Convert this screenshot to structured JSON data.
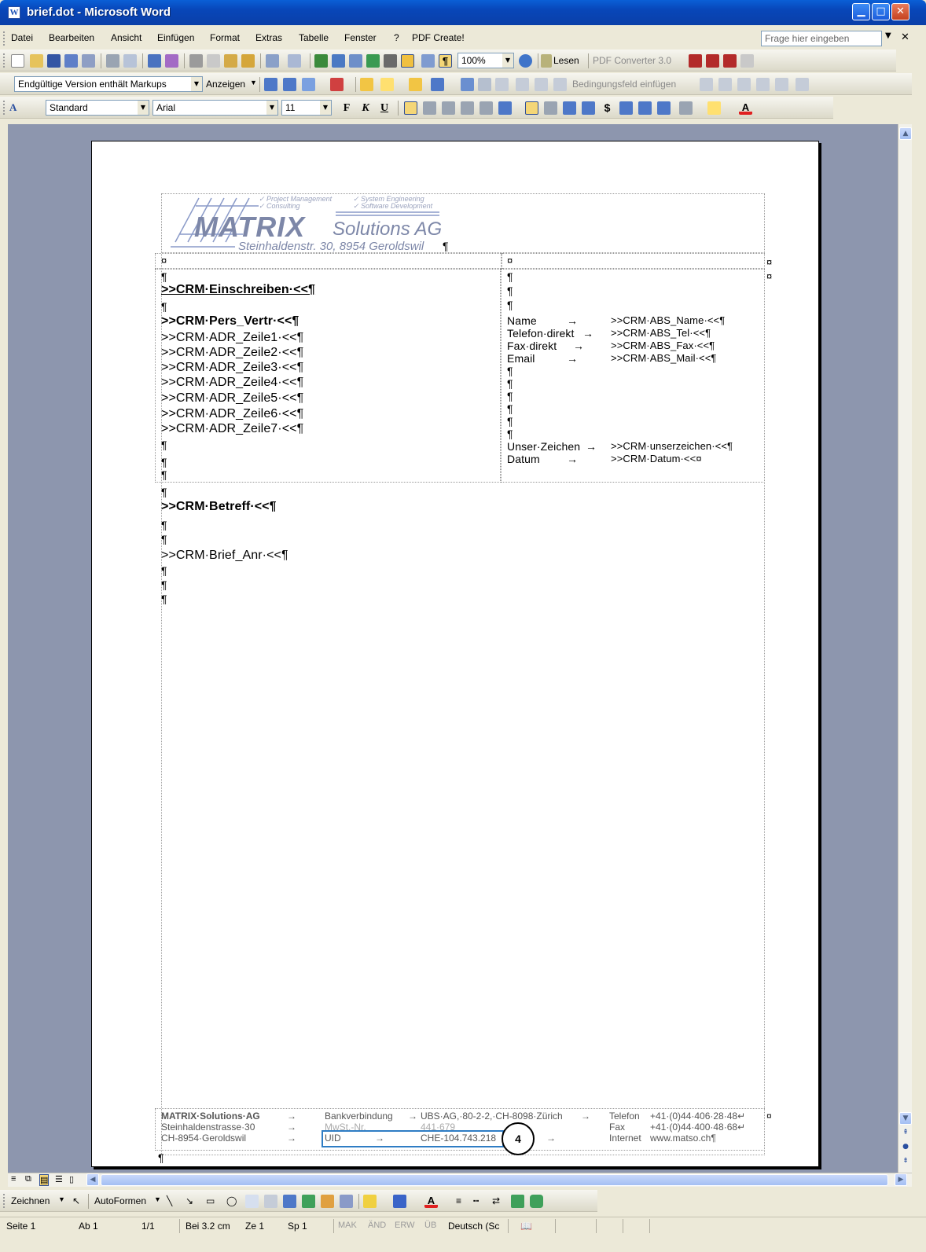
{
  "window": {
    "title": "brief.dot - Microsoft Word",
    "icon": "word-doc-icon"
  },
  "menu": {
    "items": [
      "Datei",
      "Bearbeiten",
      "Ansicht",
      "Einfügen",
      "Format",
      "Extras",
      "Tabelle",
      "Fenster",
      "?",
      "PDF Create!"
    ],
    "help_placeholder": "Frage hier eingeben"
  },
  "toolbar_standard": {
    "zoom": "100%",
    "read_label": "Lesen",
    "pdf_converter": "PDF Converter 3.0"
  },
  "toolbar_review": {
    "markup_view": "Endgültige Version enthält Markups",
    "show_label": "Anzeigen",
    "field_label": "Bedingungsfeld einfügen"
  },
  "toolbar_format": {
    "style": "Standard",
    "font": "Arial",
    "size": "11",
    "bold": "F",
    "italic": "K",
    "underline": "U"
  },
  "document": {
    "logo": {
      "company": "MATRIX",
      "solutions": "Solutions AG",
      "tag1": "✓ Project Management",
      "tag2": "✓ Consulting",
      "tag3": "✓ System Engineering",
      "tag4": "✓ Software Development",
      "address": "Steinhaldenstr. 30, 8954 Geroldswil",
      "pilcrow": "¶"
    },
    "cell_mark": "¤",
    "pilcrow": "¶",
    "left_col": {
      "einschreiben": ">>CRM·Einschreiben·<<¶",
      "pers_vertr": ">>CRM·Pers_Vertr·<<¶",
      "addr_lines": [
        ">>CRM·ADR_Zeile1·<<¶",
        ">>CRM·ADR_Zeile2·<<¶",
        ">>CRM·ADR_Zeile3·<<¶",
        ">>CRM·ADR_Zeile4·<<¶",
        ">>CRM·ADR_Zeile5·<<¶",
        ">>CRM·ADR_Zeile6·<<¶",
        ">>CRM·ADR_Zeile7·<<¶"
      ]
    },
    "right_col": {
      "name_label": "Name",
      "name_value": ">>CRM·ABS_Name·<<¶",
      "tel_label": "Telefon·direkt",
      "tel_value": ">>CRM·ABS_Tel·<<¶",
      "fax_label": "Fax·direkt",
      "fax_value": ">>CRM·ABS_Fax·<<¶",
      "email_label": "Email",
      "email_value": ">>CRM·ABS_Mail·<<¶",
      "zeichen_label": "Unser·Zeichen",
      "zeichen_value": ">>CRM·unserzeichen·<<¶",
      "datum_label": "Datum",
      "datum_value": ">>CRM·Datum·<<¤",
      "arrow": "→"
    },
    "betreff": ">>CRM·Betreff·<<¶",
    "anrede": ">>CRM·Brief_Anr·<<¶",
    "footer": {
      "company": "MATRIX·Solutions·AG",
      "street": "Steinhaldenstrasse·30",
      "city": "CH-8954·Geroldswil",
      "bank_label": "Bankverbindung",
      "bank_value": "UBS·AG,·80-2-2,·CH-8098·Zürich",
      "mwst_label": "MwSt.-Nr.",
      "mwst_value": "441·679",
      "uid_label": "UID",
      "uid_value": "CHE-104.743.218",
      "phone_label": "Telefon",
      "phone_value": "+41·(0)44·406·28·48↵",
      "fax_label": "Fax",
      "fax_value": "+41·(0)44·400·48·68↵",
      "internet_label": "Internet",
      "internet_value": "www.matso.ch¶"
    }
  },
  "callout": {
    "number": "4"
  },
  "draw_toolbar": {
    "draw_label": "Zeichnen",
    "autoshapes_label": "AutoFormen"
  },
  "status": {
    "page": "Seite 1",
    "section": "Ab 1",
    "pages": "1/1",
    "position": "Bei 3.2 cm",
    "line": "Ze 1",
    "column": "Sp 1",
    "mak": "MAK",
    "and": "ÄND",
    "erw": "ERW",
    "ub": "ÜB",
    "language": "Deutsch (Sc"
  },
  "colors": {
    "titlebar": "#0a5fd6",
    "workspace": "#8d96ae",
    "callout_border": "#2f7dc4",
    "spell_error": "#e02020"
  }
}
